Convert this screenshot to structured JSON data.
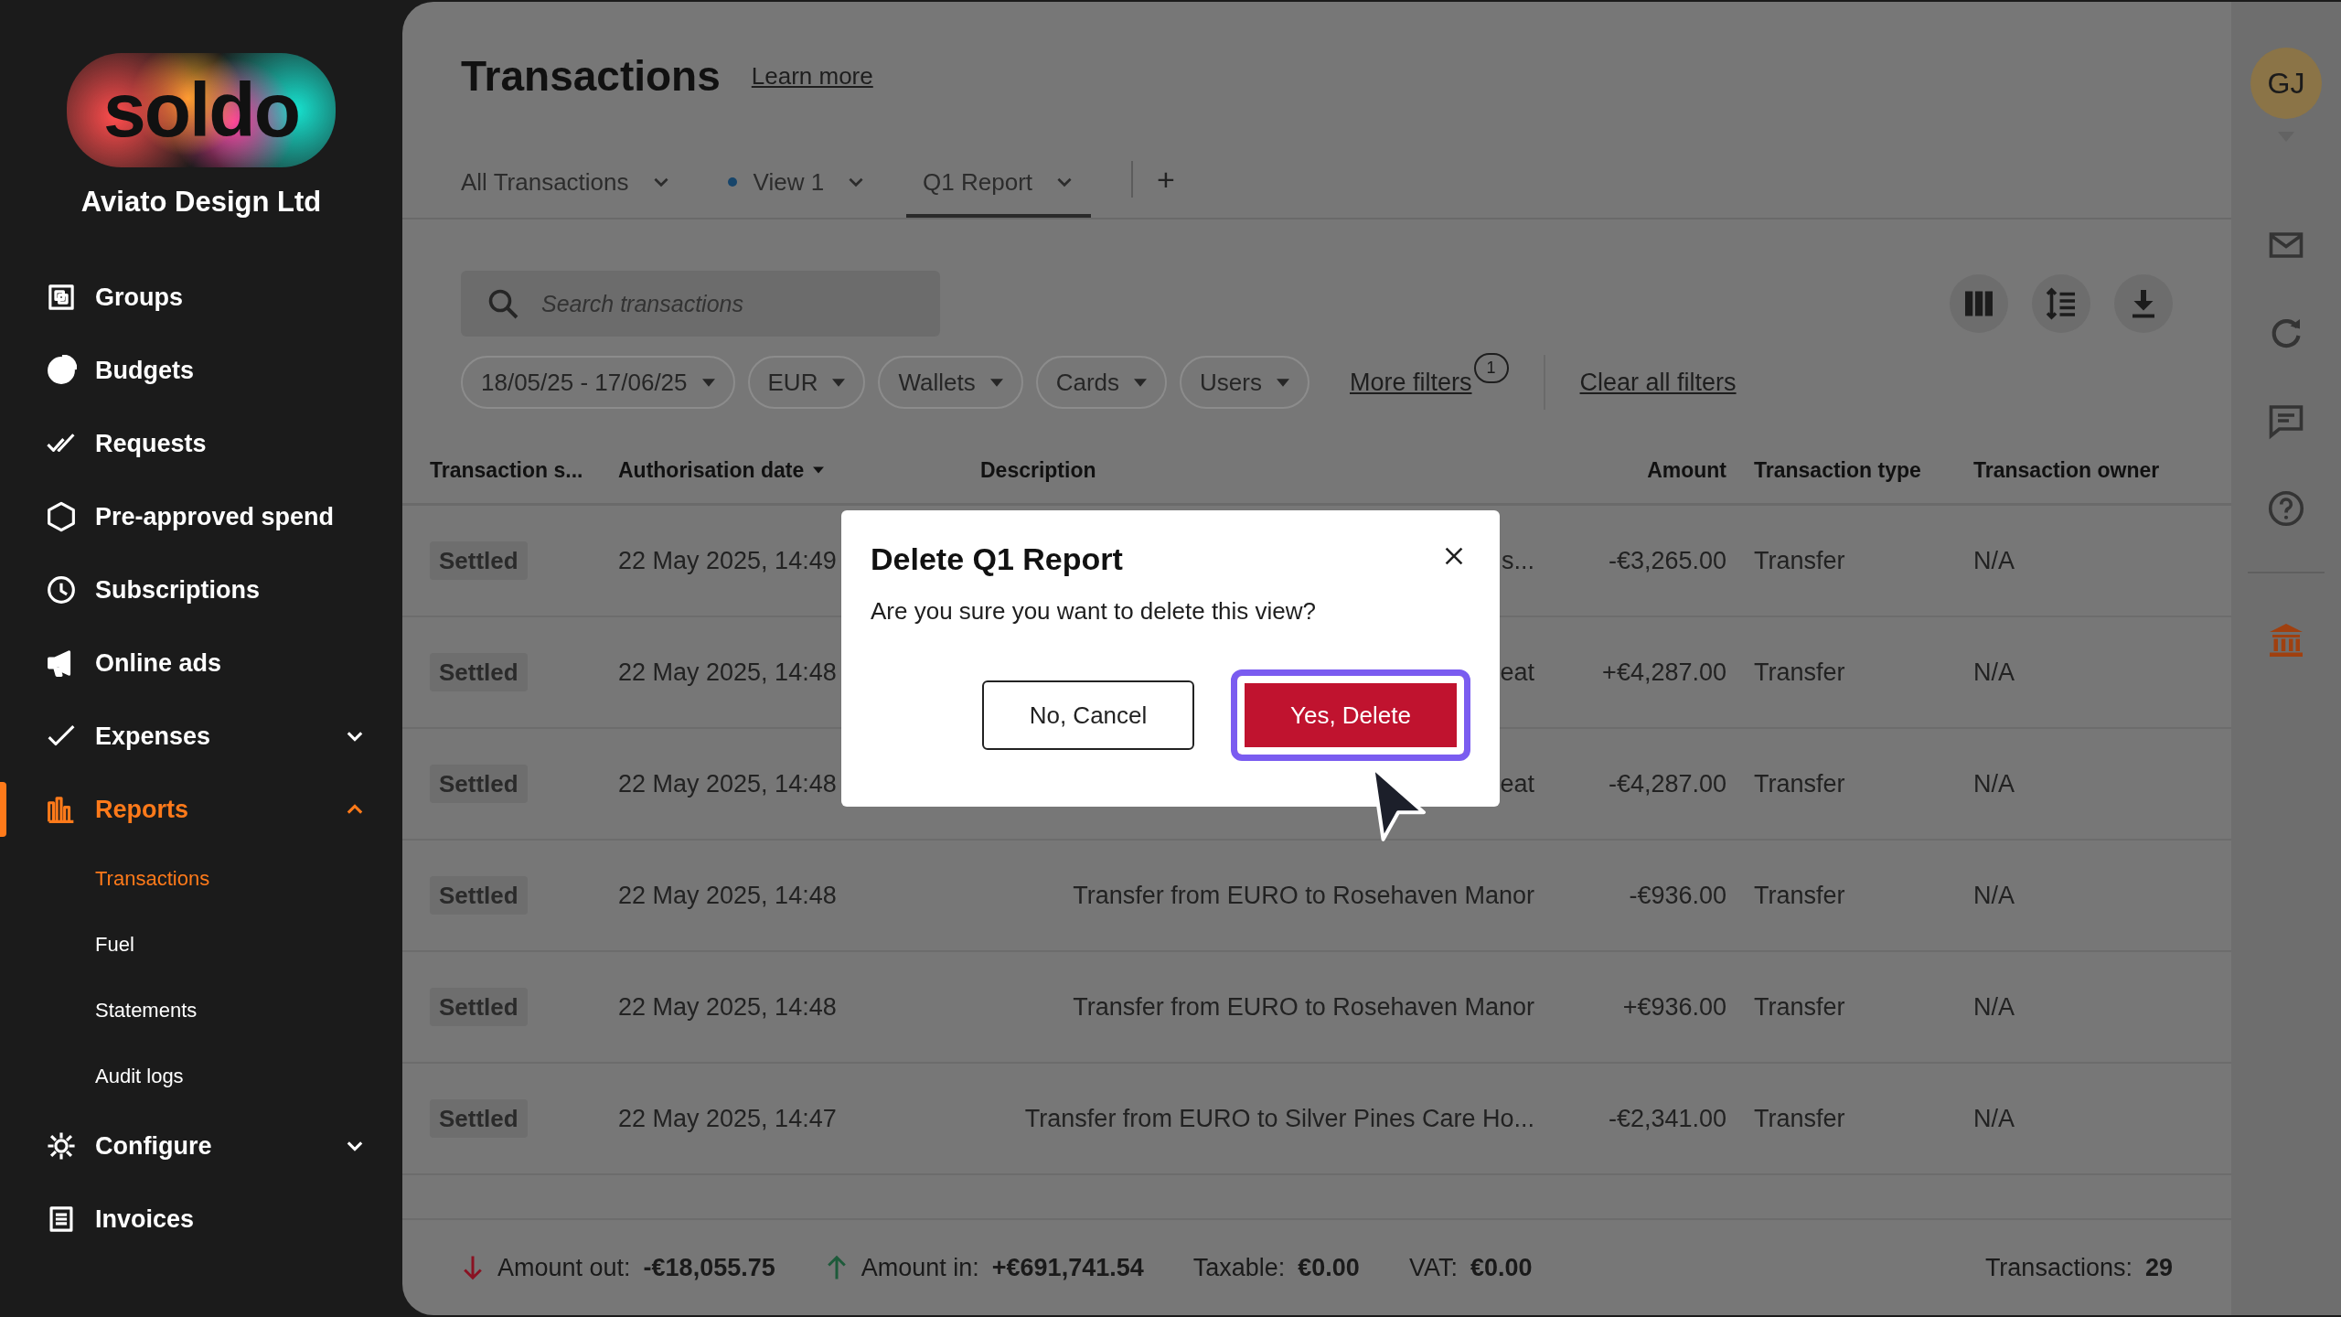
{
  "sidebar": {
    "logo": "soldo",
    "company": "Aviato Design Ltd",
    "items": [
      {
        "label": "Groups",
        "selected": false
      },
      {
        "label": "Budgets",
        "selected": false
      },
      {
        "label": "Requests",
        "selected": false
      },
      {
        "label": "Pre-approved spend",
        "selected": false
      },
      {
        "label": "Subscriptions",
        "selected": false
      },
      {
        "label": "Online ads",
        "selected": false
      },
      {
        "label": "Expenses",
        "selected": false,
        "expanded": false
      },
      {
        "label": "Reports",
        "selected": true,
        "expanded": true,
        "children": [
          {
            "label": "Transactions",
            "selected": true
          },
          {
            "label": "Fuel",
            "selected": false
          },
          {
            "label": "Statements",
            "selected": false
          },
          {
            "label": "Audit logs",
            "selected": false
          }
        ]
      },
      {
        "label": "Configure",
        "selected": false,
        "expanded": false
      },
      {
        "label": "Invoices",
        "selected": false
      }
    ]
  },
  "page": {
    "title": "Transactions",
    "learn_more": "Learn more"
  },
  "tabs": [
    {
      "label": "All Transactions",
      "selected": false,
      "modified": false
    },
    {
      "label": "View 1",
      "selected": false,
      "modified": true
    },
    {
      "label": "Q1 Report",
      "selected": true,
      "modified": false
    }
  ],
  "add_tab": "+",
  "search": {
    "placeholder": "Search transactions"
  },
  "filters": [
    "18/05/25 - 17/06/25",
    "EUR",
    "Wallets",
    "Cards",
    "Users"
  ],
  "more_filters": {
    "label": "More filters",
    "count": "1"
  },
  "clear_filters": "Clear all filters",
  "table": {
    "columns": [
      {
        "label": "Transaction s...",
        "sorted": false
      },
      {
        "label": "Authorisation date",
        "sorted": true
      },
      {
        "label": "Description",
        "sorted": false
      },
      {
        "label": "Amount",
        "sorted": false
      },
      {
        "label": "Transaction type",
        "sorted": false
      },
      {
        "label": "Transaction owner",
        "sorted": false
      }
    ],
    "rows": [
      {
        "status": "Settled",
        "date": "22 May 2025, 14:49",
        "description": "s...",
        "amount": "-€3,265.00",
        "type": "Transfer",
        "owner": "N/A"
      },
      {
        "status": "Settled",
        "date": "22 May 2025, 14:48",
        "description": "eat",
        "amount": "+€4,287.00",
        "type": "Transfer",
        "owner": "N/A"
      },
      {
        "status": "Settled",
        "date": "22 May 2025, 14:48",
        "description": "eat",
        "amount": "-€4,287.00",
        "type": "Transfer",
        "owner": "N/A"
      },
      {
        "status": "Settled",
        "date": "22 May 2025, 14:48",
        "description": "Transfer from EURO to Rosehaven Manor",
        "amount": "-€936.00",
        "type": "Transfer",
        "owner": "N/A"
      },
      {
        "status": "Settled",
        "date": "22 May 2025, 14:48",
        "description": "Transfer from EURO to Rosehaven Manor",
        "amount": "+€936.00",
        "type": "Transfer",
        "owner": "N/A"
      },
      {
        "status": "Settled",
        "date": "22 May 2025, 14:47",
        "description": "Transfer from EURO to Silver Pines Care Ho...",
        "amount": "-€2,341.00",
        "type": "Transfer",
        "owner": "N/A"
      }
    ]
  },
  "footer": {
    "amount_out": {
      "label": "Amount out:",
      "value": "-€18,055.75"
    },
    "amount_in": {
      "label": "Amount in:",
      "value": "+€691,741.54"
    },
    "taxable": {
      "label": "Taxable:",
      "value": "€0.00"
    },
    "vat": {
      "label": "VAT:",
      "value": "€0.00"
    },
    "count": {
      "label": "Transactions:",
      "value": "29"
    }
  },
  "avatar": "GJ",
  "dialog": {
    "title": "Delete Q1 Report",
    "message": "Are you sure you want to delete this view?",
    "cancel": "No, Cancel",
    "confirm": {
      "label": "Yes, Delete",
      "focused": true
    }
  }
}
